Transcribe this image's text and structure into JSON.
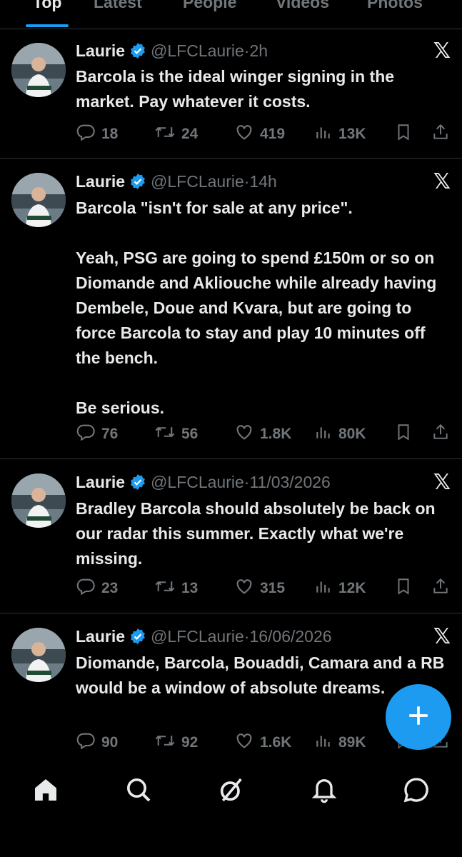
{
  "tabs": [
    "Top",
    "Latest",
    "People",
    "Videos",
    "Photos"
  ],
  "colors": {
    "accent": "#1d9bf0",
    "muted": "#71767b",
    "text": "#e7e9ea",
    "background": "#000000"
  },
  "tweets": [
    {
      "name": "Laurie",
      "handle": "@LFCLaurie",
      "dot": "·",
      "time": "2h",
      "text": "Barcola is the ideal winger signing in the market. Pay whatever it costs.",
      "replies": "18",
      "retweets": "24",
      "likes": "419",
      "views": "13K"
    },
    {
      "name": "Laurie",
      "handle": "@LFCLaurie",
      "dot": "·",
      "time": "14h",
      "text": "Barcola \"isn't for sale at any price\".\n\nYeah, PSG are going to spend £150m or so on Diomande and Akliouche while already having Dembele, Doue and Kvara, but are going to force Barcola to stay and play 10 minutes off the bench.\n\nBe serious.",
      "replies": "76",
      "retweets": "56",
      "likes": "1.8K",
      "views": "80K"
    },
    {
      "name": "Laurie",
      "handle": "@LFCLaurie",
      "dot": "·",
      "time": "11/03/2026",
      "text": "Bradley Barcola should absolutely be back on our radar this summer. Exactly what we're missing.",
      "replies": "23",
      "retweets": "13",
      "likes": "315",
      "views": "12K"
    },
    {
      "name": "Laurie",
      "handle": "@LFCLaurie",
      "dot": "·",
      "time": "16/06/2026",
      "text": "Diomande, Barcola, Bouaddi, Camara and a RB would be a window of absolute dreams.",
      "replies": "90",
      "retweets": "92",
      "likes": "1.6K",
      "views": "89K"
    }
  ],
  "icons": {
    "reply": "reply-icon",
    "retweet": "retweet-icon",
    "like": "heart-icon",
    "views": "views-icon",
    "bookmark": "bookmark-icon",
    "share": "share-icon",
    "x_logo": "x-logo-icon",
    "verified": "verified-badge-icon",
    "fab": "plus-icon",
    "home": "home-icon",
    "search": "search-icon",
    "grok": "grok-icon",
    "notifications": "bell-icon",
    "messages": "messages-icon"
  },
  "x_logo_glyph": "𝕏",
  "fab_glyph": "+"
}
